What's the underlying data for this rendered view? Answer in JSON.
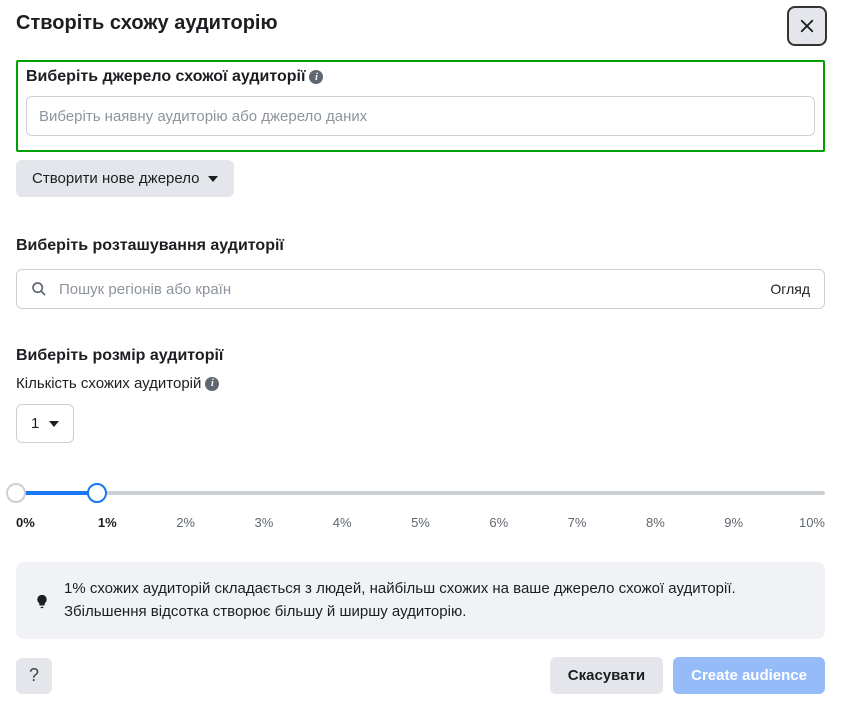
{
  "header": {
    "title": "Створіть схожу аудиторію"
  },
  "source": {
    "label": "Виберіть джерело схожої аудиторії",
    "placeholder": "Виберіть наявну аудиторію або джерело даних",
    "new_source_label": "Створити нове джерело"
  },
  "location": {
    "label": "Виберіть розташування аудиторії",
    "placeholder": "Пошук регіонів або країн",
    "browse_label": "Огляд"
  },
  "size": {
    "label": "Виберіть розмір аудиторії",
    "count_label": "Кількість схожих аудиторій",
    "count_value": "1",
    "slider_ticks": [
      "0%",
      "1%",
      "2%",
      "3%",
      "4%",
      "5%",
      "6%",
      "7%",
      "8%",
      "9%",
      "10%"
    ],
    "slider_fill_percent": 10,
    "handle_positions": [
      0,
      10
    ]
  },
  "hint": {
    "text": "1% схожих аудиторій складається з людей, найбільш схожих на ваше джерело схожої аудиторії. Збільшення відсотка створює більшу й ширшу аудиторію."
  },
  "footer": {
    "cancel_label": "Скасувати",
    "create_label": "Create audience"
  }
}
